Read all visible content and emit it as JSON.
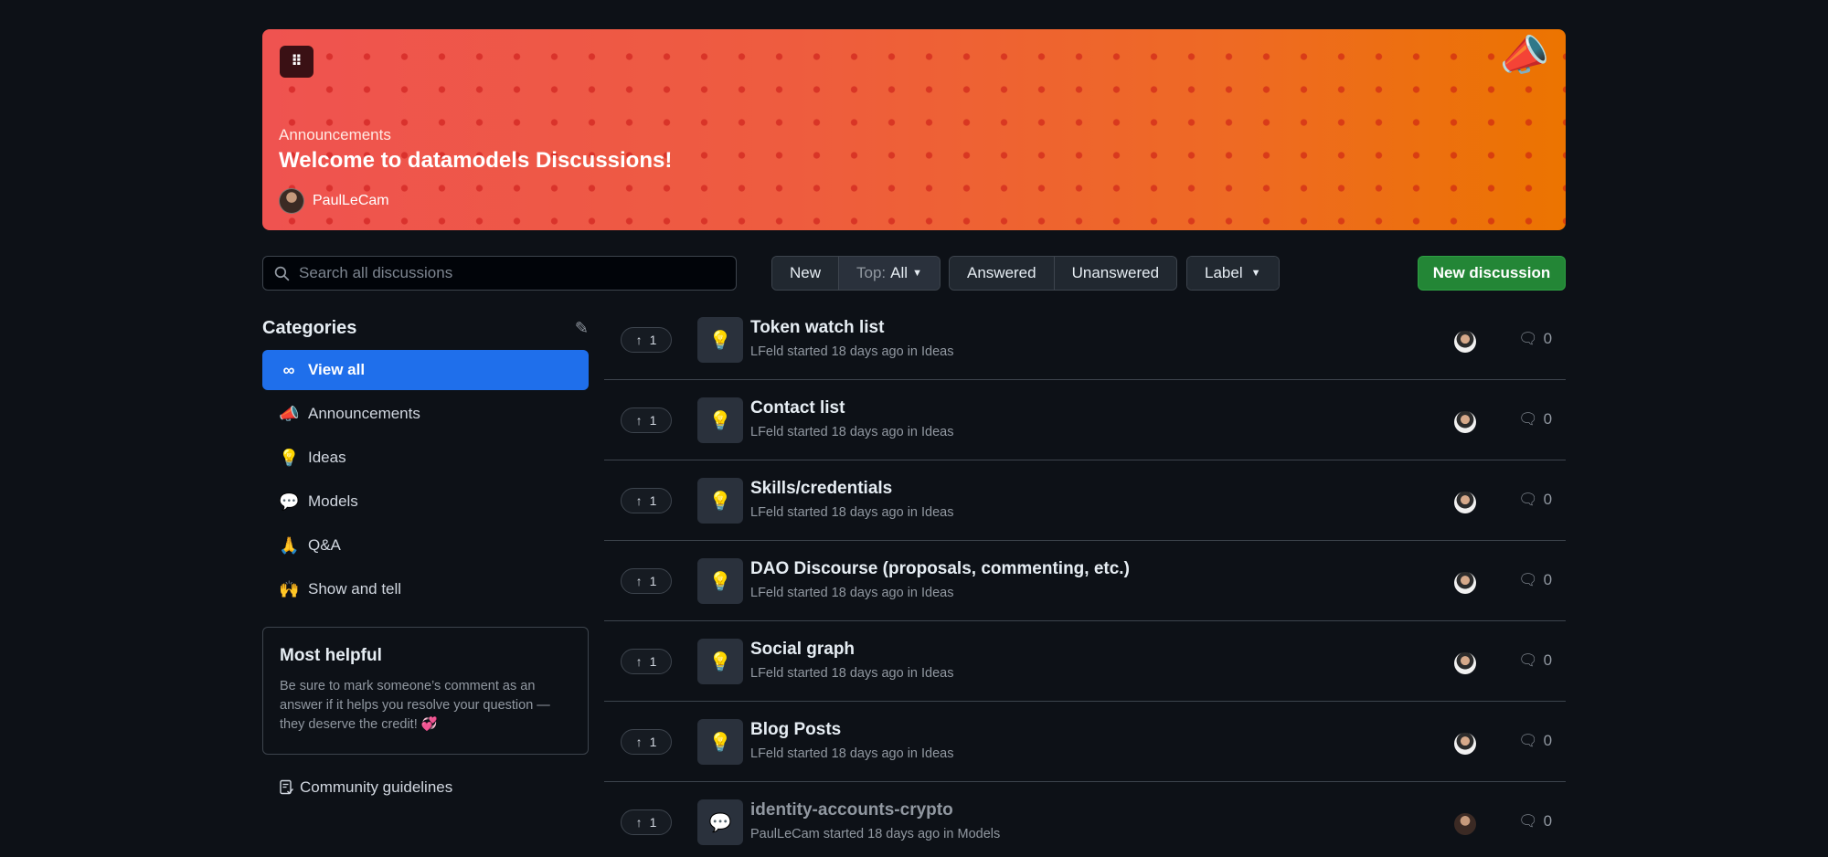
{
  "banner": {
    "grip_icon": "⠿",
    "emoji": "📣",
    "category": "Announcements",
    "title": "Welcome to datamodels Discussions!",
    "author": "PaulLeCam"
  },
  "toolbar": {
    "search_placeholder": "Search all discussions",
    "sort_new": "New",
    "sort_top_prefix": "Top:",
    "sort_top_value": "All",
    "filter_answered": "Answered",
    "filter_unanswered": "Unanswered",
    "label_menu": "Label",
    "new_discussion": "New discussion"
  },
  "sidebar": {
    "title": "Categories",
    "categories": [
      {
        "emoji": "∞",
        "label": "View all",
        "active": true
      },
      {
        "emoji": "📣",
        "label": "Announcements"
      },
      {
        "emoji": "💡",
        "label": "Ideas"
      },
      {
        "emoji": "💬",
        "label": "Models"
      },
      {
        "emoji": "🙏",
        "label": "Q&A"
      },
      {
        "emoji": "🙌",
        "label": "Show and tell"
      }
    ],
    "most_helpful": {
      "title": "Most helpful",
      "text": "Be sure to mark someone’s comment as an answer if it helps you resolve your question — they deserve the credit! 💞"
    },
    "guidelines": "Community guidelines"
  },
  "discussions": [
    {
      "votes": "1",
      "icon": "💡",
      "title": "Token watch list",
      "meta": "LFeld started 18 days ago in Ideas",
      "comments": "0"
    },
    {
      "votes": "1",
      "icon": "💡",
      "title": "Contact list",
      "meta": "LFeld started 18 days ago in Ideas",
      "comments": "0"
    },
    {
      "votes": "1",
      "icon": "💡",
      "title": "Skills/credentials",
      "meta": "LFeld started 18 days ago in Ideas",
      "comments": "0"
    },
    {
      "votes": "1",
      "icon": "💡",
      "title": "DAO Discourse (proposals, commenting, etc.)",
      "meta": "LFeld started 18 days ago in Ideas",
      "comments": "0"
    },
    {
      "votes": "1",
      "icon": "💡",
      "title": "Social graph",
      "meta": "LFeld started 18 days ago in Ideas",
      "comments": "0"
    },
    {
      "votes": "1",
      "icon": "💡",
      "title": "Blog Posts",
      "meta": "LFeld started 18 days ago in Ideas",
      "comments": "0"
    },
    {
      "votes": "1",
      "icon": "💬",
      "title": "identity-accounts-crypto",
      "meta": "PaulLeCam started 18 days ago in Models",
      "comments": "0"
    }
  ]
}
